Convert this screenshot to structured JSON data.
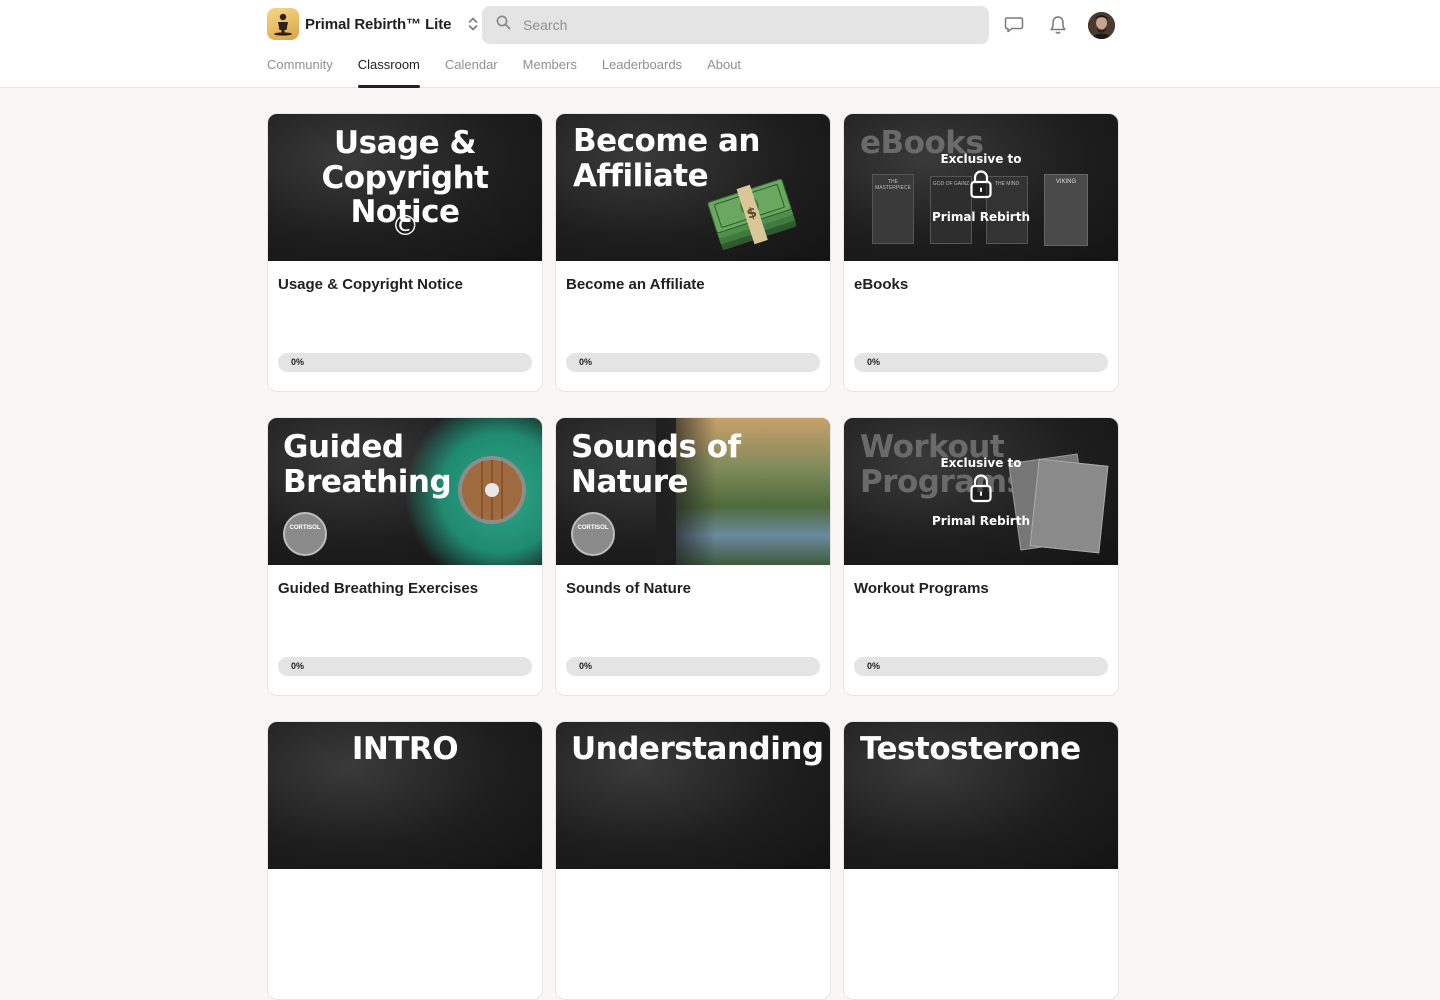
{
  "header": {
    "brand_name": "Primal Rebirth™ Lite",
    "search_placeholder": "Search"
  },
  "tabs": [
    {
      "label": "Community",
      "active": false
    },
    {
      "label": "Classroom",
      "active": true
    },
    {
      "label": "Calendar",
      "active": false
    },
    {
      "label": "Members",
      "active": false
    },
    {
      "label": "Leaderboards",
      "active": false
    },
    {
      "label": "About",
      "active": false
    }
  ],
  "courses": [
    {
      "title": "Usage & Copyright Notice",
      "progress_label": "0%",
      "progress": 0,
      "thumb": {
        "lines": [
          "Usage &",
          "Copyright Notice"
        ],
        "symbol": "©"
      }
    },
    {
      "title": "Become an Affiliate",
      "progress_label": "0%",
      "progress": 0,
      "thumb": {
        "lines": [
          "Become an",
          "Affiliate"
        ]
      }
    },
    {
      "title": "eBooks",
      "progress_label": "0%",
      "progress": 0,
      "thumb": {
        "lines": [
          "eBooks"
        ],
        "lock_top": "Exclusive to",
        "lock_bottom": "Primal Rebirth",
        "book_labels": [
          "THE MASTERPIECE",
          "GOD OF GAINZ",
          "THE MIND",
          "VIKING"
        ]
      }
    },
    {
      "title": "Guided Breathing Exercises",
      "progress_label": "0%",
      "progress": 0,
      "thumb": {
        "lines": [
          "Guided",
          "Breathing"
        ],
        "badge": "CORTISOL"
      }
    },
    {
      "title": "Sounds of Nature",
      "progress_label": "0%",
      "progress": 0,
      "thumb": {
        "lines": [
          "Sounds of",
          "Nature"
        ],
        "badge": "CORTISOL"
      }
    },
    {
      "title": "Workout Programs",
      "progress_label": "0%",
      "progress": 0,
      "thumb": {
        "lines": [
          "Workout",
          "Programs"
        ],
        "lock_top": "Exclusive to",
        "lock_bottom": "Primal Rebirth"
      }
    },
    {
      "thumb": {
        "lines": [
          "INTRO"
        ]
      }
    },
    {
      "thumb": {
        "lines": [
          "Understanding"
        ]
      }
    },
    {
      "thumb": {
        "lines": [
          "Testosterone"
        ]
      }
    }
  ]
}
